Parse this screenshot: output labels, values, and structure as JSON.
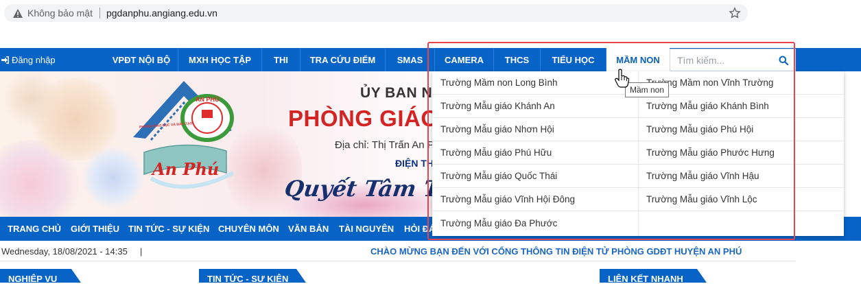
{
  "browser": {
    "security_label": "Không bảo mật",
    "url": "pgdanphu.angiang.edu.vn"
  },
  "topnav": {
    "login_label": "Đăng nhập",
    "items": [
      "VPĐT NỘI BỘ",
      "MXH HỌC TẬP",
      "THI",
      "TRA CỨU ĐIỂM",
      "SMAS",
      "CAMERA",
      "THCS",
      "TIỂU HỌC",
      "MẦM NON"
    ],
    "active_item": "MẦM NON",
    "search_placeholder": "Tìm kiếm..."
  },
  "banner": {
    "line1": "ỦY BAN NHÂ",
    "line2": "PHÒNG GIÁO",
    "address": "Địa chỉ: Thị Trấn An P",
    "phone": "ĐIỆN TH",
    "slogan": "Quyết Tâm Thi",
    "logo_top_text": "AN PHÚ",
    "logo_small_text": "PHÒNG GIÁO DỤC VÀ ĐÀO TẠO",
    "logo_script": "An Phú"
  },
  "mainnav": {
    "items": [
      "TRANG CHỦ",
      "GIỚI THIỆU",
      "TIN TỨC - SỰ KIỆN",
      "CHUYÊN MÔN",
      "VĂN BẢN",
      "TÀI NGUYÊN",
      "HỎI ĐÁ"
    ]
  },
  "datebar": {
    "date": "Wednesday, 18/08/2021 - 14:35",
    "pipe": "|",
    "welcome": "CHÀO MỪNG BẠN ĐẾN VỚI CỔNG THÔNG TIN ĐIỆN TỬ PHÒNG GDĐT HUYỆN AN PHÚ"
  },
  "sections": [
    "NGHIỆP VỤ",
    "TIN TỨC - SỰ KIỆN",
    "LIÊN KẾT NHANH"
  ],
  "dropdown": {
    "left": [
      "Trường Mầm non Long Bình",
      "Trường Mẫu giáo Khánh An",
      "Trường Mẫu giáo Nhơn Hội",
      "Trường Mẫu giáo Phú Hữu",
      "Trường Mẫu giáo Quốc Thái",
      "Trường Mẫu giáo Vĩnh Hội Đông",
      "Trường Mẫu giáo Đa Phước"
    ],
    "right": [
      "Trường Mầm non Vĩnh Trường",
      "Trường Mẫu giáo Khánh Bình",
      "Trường Mẫu giáo Phú Hội",
      "Trường Mẫu giáo Phước Hưng",
      "Trường Mẫu giáo Vĩnh Hậu",
      "Trường Mẫu giáo Vĩnh Lộc"
    ]
  },
  "tooltip": "Mầm non",
  "colors": {
    "nav_blue": "#0764c6",
    "title_red": "#d42323",
    "highlight": "#e84450"
  }
}
